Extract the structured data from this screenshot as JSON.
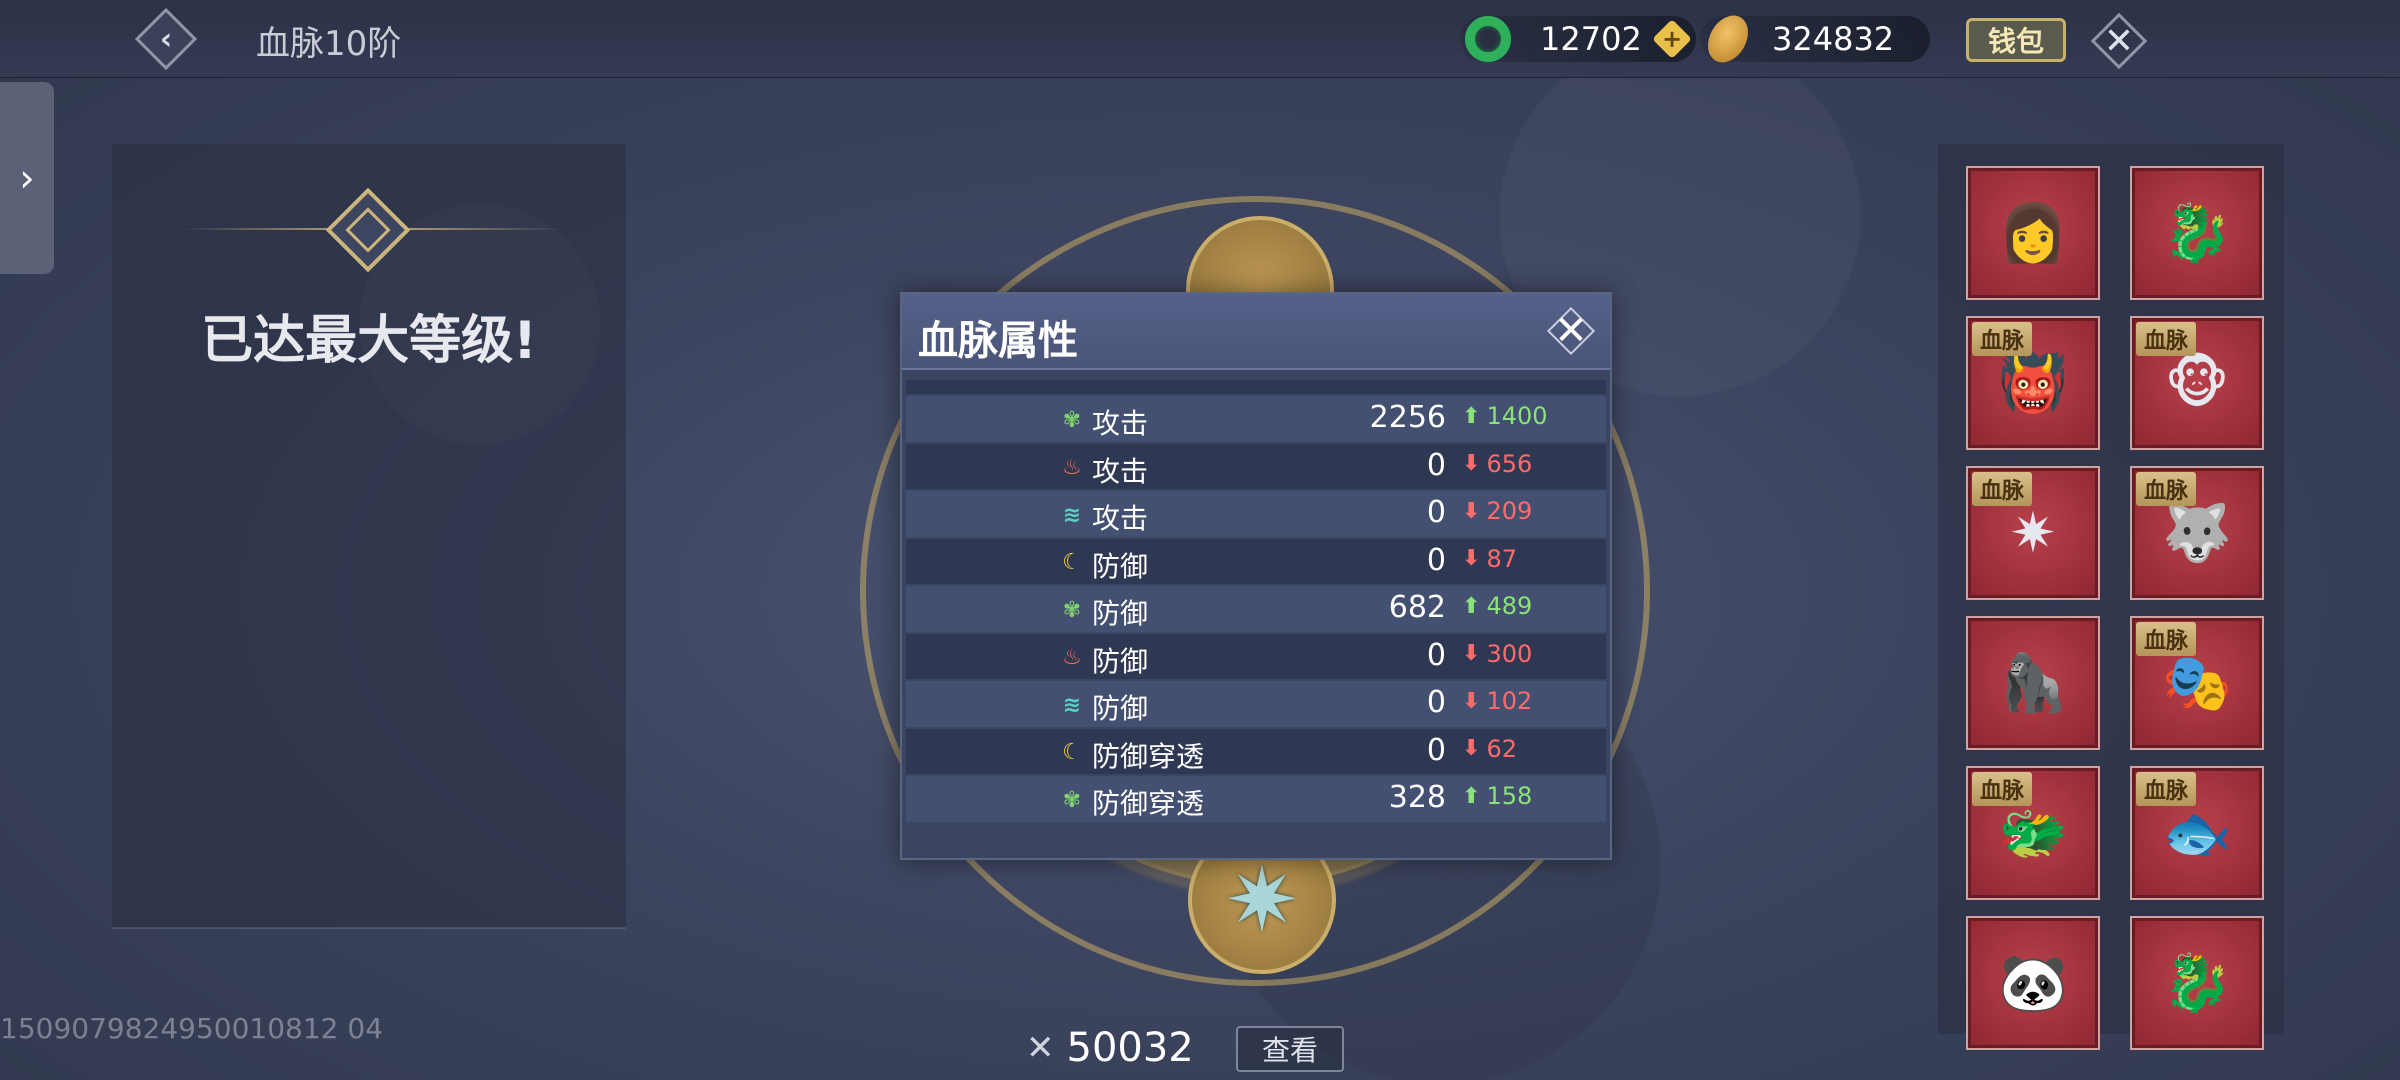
{
  "header": {
    "title": "血脉10阶",
    "jade_amount": "12702",
    "coin_amount": "324832",
    "wallet_label": "钱包"
  },
  "left_panel": {
    "max_level_text": "已达最大等级!",
    "uid": "1509079824950010812 04"
  },
  "popup": {
    "title": "血脉属性",
    "rows": [
      {
        "element": "wood",
        "icon": "wood-element-icon",
        "name": "攻击",
        "value": "2256",
        "diff_dir": "up",
        "diff": "1400"
      },
      {
        "element": "fire",
        "icon": "fire-element-icon",
        "name": "攻击",
        "value": "0",
        "diff_dir": "down",
        "diff": "656"
      },
      {
        "element": "wind",
        "icon": "wind-element-icon",
        "name": "攻击",
        "value": "0",
        "diff_dir": "down",
        "diff": "209"
      },
      {
        "element": "moon",
        "icon": "moon-element-icon",
        "name": "防御",
        "value": "0",
        "diff_dir": "down",
        "diff": "87"
      },
      {
        "element": "wood",
        "icon": "wood-element-icon",
        "name": "防御",
        "value": "682",
        "diff_dir": "up",
        "diff": "489"
      },
      {
        "element": "fire",
        "icon": "fire-element-icon",
        "name": "防御",
        "value": "0",
        "diff_dir": "down",
        "diff": "300"
      },
      {
        "element": "wind",
        "icon": "wind-element-icon",
        "name": "防御",
        "value": "0",
        "diff_dir": "down",
        "diff": "102"
      },
      {
        "element": "moon",
        "icon": "moon-element-icon",
        "name": "防御穿透",
        "value": "0",
        "diff_dir": "down",
        "diff": "62"
      },
      {
        "element": "wood",
        "icon": "wood-element-icon",
        "name": "防御穿透",
        "value": "328",
        "diff_dir": "up",
        "diff": "158"
      }
    ]
  },
  "bottom": {
    "power_value": "50032",
    "view_label": "查看"
  },
  "beast_cards": [
    {
      "tag": "",
      "icon": "maidens-icon",
      "glyph": "👩"
    },
    {
      "tag": "",
      "icon": "dragon-icon",
      "glyph": "🐉"
    },
    {
      "tag": "血脉",
      "icon": "demon-icon",
      "glyph": "👹"
    },
    {
      "tag": "血脉",
      "icon": "monkey-icon",
      "glyph": "🐵"
    },
    {
      "tag": "血脉",
      "icon": "starfish-icon",
      "glyph": "✷"
    },
    {
      "tag": "血脉",
      "icon": "fire-wolf-icon",
      "glyph": "🐺"
    },
    {
      "tag": "",
      "icon": "gorilla-icon",
      "glyph": "🦍"
    },
    {
      "tag": "血脉",
      "icon": "red-mask-icon",
      "glyph": "🎭"
    },
    {
      "tag": "血脉",
      "icon": "white-dragon-icon",
      "glyph": "🐲"
    },
    {
      "tag": "血脉",
      "icon": "blue-fish-icon",
      "glyph": "🐟"
    },
    {
      "tag": "",
      "icon": "panda-icon",
      "glyph": "🐼"
    },
    {
      "tag": "",
      "icon": "red-dragon-icon",
      "glyph": "🐉"
    }
  ]
}
